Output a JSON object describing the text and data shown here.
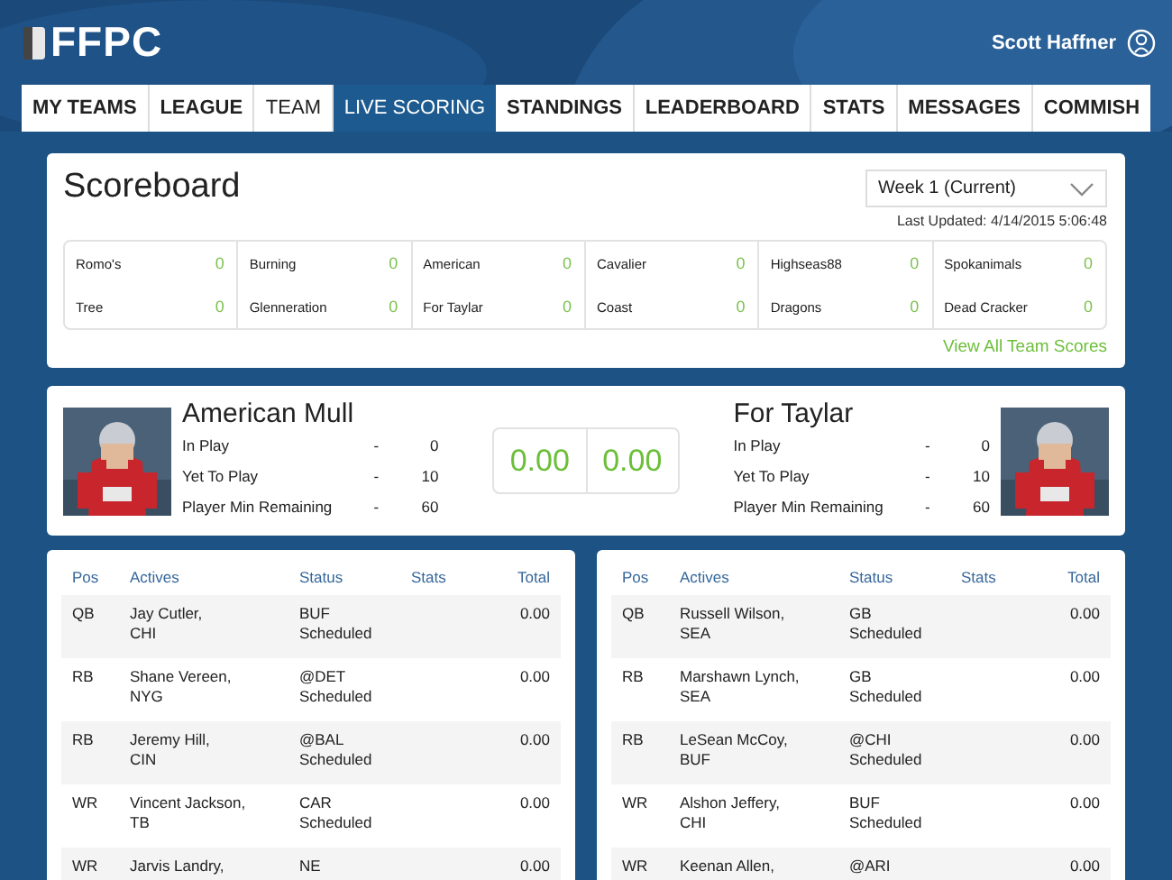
{
  "header": {
    "logo": "FFPC",
    "user": "Scott Haffner"
  },
  "tabs": [
    {
      "label": "MY TEAMS",
      "selected": false,
      "bold": true
    },
    {
      "label": "LEAGUE",
      "selected": false,
      "bold": true
    },
    {
      "label": "TEAM",
      "selected": false,
      "bold": false
    },
    {
      "label": "LIVE SCORING",
      "selected": true,
      "bold": false
    },
    {
      "label": "STANDINGS",
      "selected": false,
      "bold": true
    },
    {
      "label": "LEADERBOARD",
      "selected": false,
      "bold": true
    },
    {
      "label": "STATS",
      "selected": false,
      "bold": true
    },
    {
      "label": "MESSAGES",
      "selected": false,
      "bold": true
    },
    {
      "label": "COMMISH",
      "selected": false,
      "bold": true
    }
  ],
  "scoreboard": {
    "title": "Scoreboard",
    "week": "Week 1 (Current)",
    "last_updated": "Last Updated: 4/14/2015 5:06:48",
    "matchups": [
      [
        {
          "team": "Romo's",
          "score": "0"
        },
        {
          "team": "Tree",
          "score": "0"
        }
      ],
      [
        {
          "team": "Burning",
          "score": "0"
        },
        {
          "team": "Glenneration",
          "score": "0"
        }
      ],
      [
        {
          "team": "American",
          "score": "0"
        },
        {
          "team": "For Taylar",
          "score": "0"
        }
      ],
      [
        {
          "team": "Cavalier",
          "score": "0"
        },
        {
          "team": "Coast",
          "score": "0"
        }
      ],
      [
        {
          "team": "Highseas88",
          "score": "0"
        },
        {
          "team": "Dragons",
          "score": "0"
        }
      ],
      [
        {
          "team": "Spokanimals",
          "score": "0"
        },
        {
          "team": "Dead Cracker",
          "score": "0"
        }
      ]
    ],
    "view_all": "View All Team Scores"
  },
  "matchup": {
    "teams": [
      {
        "name": "American Mull",
        "stats": [
          {
            "label": "In Play",
            "sep": "-",
            "value": "0"
          },
          {
            "label": "Yet To Play",
            "sep": "-",
            "value": "10"
          },
          {
            "label": "Player Min Remaining",
            "sep": "-",
            "value": "60"
          }
        ],
        "score": "0.00"
      },
      {
        "name": "For Taylar",
        "stats": [
          {
            "label": "In Play",
            "sep": "-",
            "value": "0"
          },
          {
            "label": "Yet To Play",
            "sep": "-",
            "value": "10"
          },
          {
            "label": "Player Min Remaining",
            "sep": "-",
            "value": "60"
          }
        ],
        "score": "0.00"
      }
    ]
  },
  "rosters": [
    {
      "columns": [
        "Pos",
        "Actives",
        "Status",
        "Stats",
        "Total"
      ],
      "rows": [
        {
          "pos": "QB",
          "player": "Jay Cutler,",
          "team": "CHI",
          "opponent": "BUF",
          "status": "Scheduled",
          "total": "0.00"
        },
        {
          "pos": "RB",
          "player": "Shane Vereen,",
          "team": "NYG",
          "opponent": "@DET",
          "status": "Scheduled",
          "total": "0.00"
        },
        {
          "pos": "RB",
          "player": "Jeremy Hill,",
          "team": "CIN",
          "opponent": "@BAL",
          "status": "Scheduled",
          "total": "0.00"
        },
        {
          "pos": "WR",
          "player": "Vincent Jackson,",
          "team": "TB",
          "opponent": "CAR",
          "status": "Scheduled",
          "total": "0.00"
        },
        {
          "pos": "WR",
          "player": "Jarvis Landry,",
          "opponent": "NE",
          "total": "0.00"
        }
      ]
    },
    {
      "columns": [
        "Pos",
        "Actives",
        "Status",
        "Stats",
        "Total"
      ],
      "rows": [
        {
          "pos": "QB",
          "player": "Russell Wilson,",
          "team": "SEA",
          "opponent": "GB",
          "status": "Scheduled",
          "total": "0.00"
        },
        {
          "pos": "RB",
          "player": "Marshawn Lynch,",
          "team": "SEA",
          "opponent": "GB",
          "status": "Scheduled",
          "total": "0.00"
        },
        {
          "pos": "RB",
          "player": "LeSean McCoy,",
          "team": "BUF",
          "opponent": "@CHI",
          "status": "Scheduled",
          "total": "0.00"
        },
        {
          "pos": "WR",
          "player": "Alshon Jeffery,",
          "team": "CHI",
          "opponent": "BUF",
          "status": "Scheduled",
          "total": "0.00"
        },
        {
          "pos": "WR",
          "player": "Keenan Allen,",
          "opponent": "@ARI",
          "total": "0.00"
        }
      ]
    }
  ]
}
